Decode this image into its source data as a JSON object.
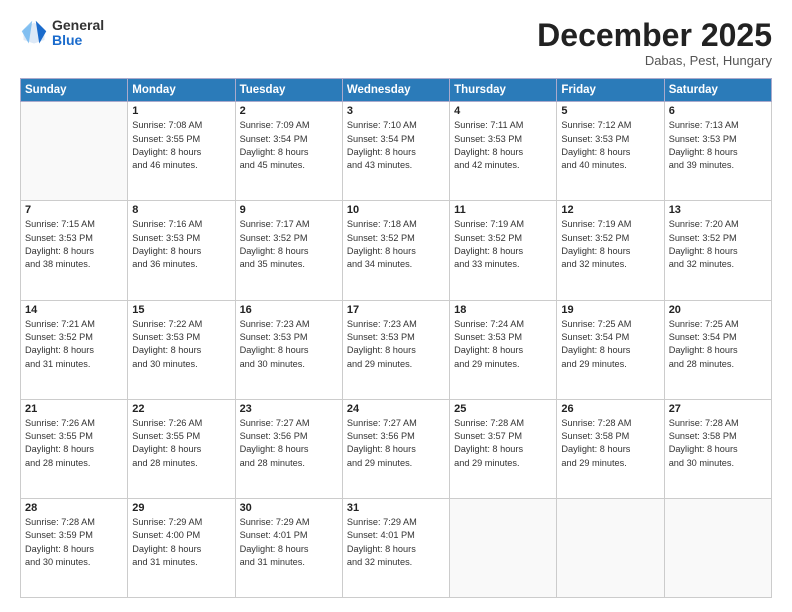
{
  "logo": {
    "general": "General",
    "blue": "Blue"
  },
  "header": {
    "month": "December 2025",
    "location": "Dabas, Pest, Hungary"
  },
  "weekdays": [
    "Sunday",
    "Monday",
    "Tuesday",
    "Wednesday",
    "Thursday",
    "Friday",
    "Saturday"
  ],
  "weeks": [
    [
      {
        "day": "",
        "info": ""
      },
      {
        "day": "1",
        "info": "Sunrise: 7:08 AM\nSunset: 3:55 PM\nDaylight: 8 hours\nand 46 minutes."
      },
      {
        "day": "2",
        "info": "Sunrise: 7:09 AM\nSunset: 3:54 PM\nDaylight: 8 hours\nand 45 minutes."
      },
      {
        "day": "3",
        "info": "Sunrise: 7:10 AM\nSunset: 3:54 PM\nDaylight: 8 hours\nand 43 minutes."
      },
      {
        "day": "4",
        "info": "Sunrise: 7:11 AM\nSunset: 3:53 PM\nDaylight: 8 hours\nand 42 minutes."
      },
      {
        "day": "5",
        "info": "Sunrise: 7:12 AM\nSunset: 3:53 PM\nDaylight: 8 hours\nand 40 minutes."
      },
      {
        "day": "6",
        "info": "Sunrise: 7:13 AM\nSunset: 3:53 PM\nDaylight: 8 hours\nand 39 minutes."
      }
    ],
    [
      {
        "day": "7",
        "info": "Sunrise: 7:15 AM\nSunset: 3:53 PM\nDaylight: 8 hours\nand 38 minutes."
      },
      {
        "day": "8",
        "info": "Sunrise: 7:16 AM\nSunset: 3:53 PM\nDaylight: 8 hours\nand 36 minutes."
      },
      {
        "day": "9",
        "info": "Sunrise: 7:17 AM\nSunset: 3:52 PM\nDaylight: 8 hours\nand 35 minutes."
      },
      {
        "day": "10",
        "info": "Sunrise: 7:18 AM\nSunset: 3:52 PM\nDaylight: 8 hours\nand 34 minutes."
      },
      {
        "day": "11",
        "info": "Sunrise: 7:19 AM\nSunset: 3:52 PM\nDaylight: 8 hours\nand 33 minutes."
      },
      {
        "day": "12",
        "info": "Sunrise: 7:19 AM\nSunset: 3:52 PM\nDaylight: 8 hours\nand 32 minutes."
      },
      {
        "day": "13",
        "info": "Sunrise: 7:20 AM\nSunset: 3:52 PM\nDaylight: 8 hours\nand 32 minutes."
      }
    ],
    [
      {
        "day": "14",
        "info": "Sunrise: 7:21 AM\nSunset: 3:52 PM\nDaylight: 8 hours\nand 31 minutes."
      },
      {
        "day": "15",
        "info": "Sunrise: 7:22 AM\nSunset: 3:53 PM\nDaylight: 8 hours\nand 30 minutes."
      },
      {
        "day": "16",
        "info": "Sunrise: 7:23 AM\nSunset: 3:53 PM\nDaylight: 8 hours\nand 30 minutes."
      },
      {
        "day": "17",
        "info": "Sunrise: 7:23 AM\nSunset: 3:53 PM\nDaylight: 8 hours\nand 29 minutes."
      },
      {
        "day": "18",
        "info": "Sunrise: 7:24 AM\nSunset: 3:53 PM\nDaylight: 8 hours\nand 29 minutes."
      },
      {
        "day": "19",
        "info": "Sunrise: 7:25 AM\nSunset: 3:54 PM\nDaylight: 8 hours\nand 29 minutes."
      },
      {
        "day": "20",
        "info": "Sunrise: 7:25 AM\nSunset: 3:54 PM\nDaylight: 8 hours\nand 28 minutes."
      }
    ],
    [
      {
        "day": "21",
        "info": "Sunrise: 7:26 AM\nSunset: 3:55 PM\nDaylight: 8 hours\nand 28 minutes."
      },
      {
        "day": "22",
        "info": "Sunrise: 7:26 AM\nSunset: 3:55 PM\nDaylight: 8 hours\nand 28 minutes."
      },
      {
        "day": "23",
        "info": "Sunrise: 7:27 AM\nSunset: 3:56 PM\nDaylight: 8 hours\nand 28 minutes."
      },
      {
        "day": "24",
        "info": "Sunrise: 7:27 AM\nSunset: 3:56 PM\nDaylight: 8 hours\nand 29 minutes."
      },
      {
        "day": "25",
        "info": "Sunrise: 7:28 AM\nSunset: 3:57 PM\nDaylight: 8 hours\nand 29 minutes."
      },
      {
        "day": "26",
        "info": "Sunrise: 7:28 AM\nSunset: 3:58 PM\nDaylight: 8 hours\nand 29 minutes."
      },
      {
        "day": "27",
        "info": "Sunrise: 7:28 AM\nSunset: 3:58 PM\nDaylight: 8 hours\nand 30 minutes."
      }
    ],
    [
      {
        "day": "28",
        "info": "Sunrise: 7:28 AM\nSunset: 3:59 PM\nDaylight: 8 hours\nand 30 minutes."
      },
      {
        "day": "29",
        "info": "Sunrise: 7:29 AM\nSunset: 4:00 PM\nDaylight: 8 hours\nand 31 minutes."
      },
      {
        "day": "30",
        "info": "Sunrise: 7:29 AM\nSunset: 4:01 PM\nDaylight: 8 hours\nand 31 minutes."
      },
      {
        "day": "31",
        "info": "Sunrise: 7:29 AM\nSunset: 4:01 PM\nDaylight: 8 hours\nand 32 minutes."
      },
      {
        "day": "",
        "info": ""
      },
      {
        "day": "",
        "info": ""
      },
      {
        "day": "",
        "info": ""
      }
    ]
  ]
}
